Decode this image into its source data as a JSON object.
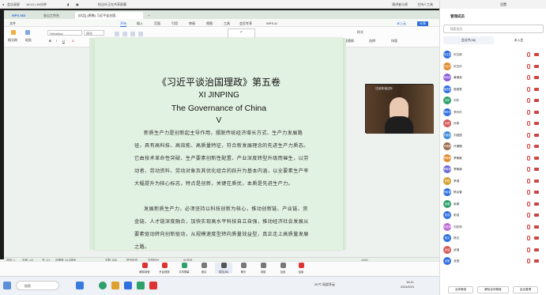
{
  "meeting": {
    "title": "会议录屏",
    "time": "16:10 | 48分钟",
    "presenter": "检达叶正在共享屏幕",
    "right_controls": [
      "演讲者与视",
      "主持人工具",
      "设置"
    ],
    "time_left": "16:11"
  },
  "browser_tabs": [
    {
      "label": "WPS 365"
    },
    {
      "label": "金山工作台"
    },
    {
      "label": "[印品] (原稿) 习近平谈治国..."
    }
  ],
  "wps_menu": [
    "文件",
    "开始",
    "插入",
    "页面",
    "引用",
    "审阅",
    "视图",
    "工具",
    "会员专享",
    "WPS AI"
  ],
  "wps_menu_active": "开始",
  "wps_right": [
    "未上云",
    "分享"
  ],
  "ribbon": {
    "format_painter": "格式刷",
    "font_name": "Helvetica",
    "font_size": "四号",
    "paste": "粘贴",
    "buttons": [
      "正文",
      "标题1",
      "标题2",
      "样式",
      "查找替换",
      "选择",
      "排版"
    ],
    "styles": [
      "正文",
      "标题 1",
      "标题 2"
    ]
  },
  "document": {
    "title": "《习近平谈治国理政》第五卷",
    "en1": "XI JINPING",
    "en2": "The Governance of China",
    "roman": "V",
    "p1": "新质生产力是创新起主导作用，摆脱传统经济增长方式、生产力发展路径，具有高科技、高效能、高质量特征，符合新发展理念的先进生产力质态。它由技术革命性突破、生产要素创新性配置、产业深度转型升级而催生，以劳动者、劳动资料、劳动对象及其优化组合的跃升为基本内涵，以全要素生产率大幅提升为核心标志，特点是创新，关键在质优，本质是先进生产力。",
    "p2": "发展新质生产力，必须坚持以科技创新为核心，推动创新链、产业链、资金链、人才链深度融合，加快实现高水平科技自立自强，推动经济社会发展从要素驱动转向创新驱动，从规模速度型转向质量效益型，真正走上高质量发展之路。"
  },
  "statusbar": [
    "页码: 1",
    "页面: 1/3",
    "节: 1/1",
    "设置值: 12.0厘米",
    "字数: 636",
    "拼写检查",
    "文档校对",
    "AI 校对",
    "116%"
  ],
  "video": {
    "name": "汪世鸿·检达叶"
  },
  "meeting_toolbar": {
    "buttons": [
      "解除静音",
      "开启视频",
      "共享屏幕",
      "邀请",
      "成员(36)",
      "聊天",
      "录制",
      "应用",
      "云录制",
      "结束"
    ]
  },
  "taskbar": {
    "search": "搜索",
    "weather": "26℃ 局部多云",
    "time": "16:11",
    "date": "2024/5/24"
  },
  "sidebar": {
    "title": "管理成员",
    "search_placeholder": "搜索成员",
    "tab_in": "会议中(36)",
    "tab_out": "未入会",
    "members": [
      {
        "name": "何玉英",
        "color": "#2f6fe0"
      },
      {
        "name": "何玉玲",
        "color": "#e08a2f"
      },
      {
        "name": "黄娴英",
        "color": "#8a5ad6"
      },
      {
        "name": "施丽君",
        "color": "#2f6fe0"
      },
      {
        "name": "刘华",
        "color": "#2fa06a"
      },
      {
        "name": "李玲玲",
        "color": "#2f6fe0"
      },
      {
        "name": "孙燕",
        "color": "#d65a5a"
      },
      {
        "name": "刘强国",
        "color": "#3a8ad6"
      },
      {
        "name": "许姗姗",
        "color": "#9a6a4a"
      },
      {
        "name": "罗敏敏",
        "color": "#e08a2f"
      },
      {
        "name": "罗敏格",
        "color": "#6a6ad6"
      },
      {
        "name": "罗瑾",
        "color": "#d6a02f"
      },
      {
        "name": "杨京春",
        "color": "#2f6fe0"
      },
      {
        "name": "俞春",
        "color": "#2fa06a"
      },
      {
        "name": "彭强",
        "color": "#2f6fe0"
      },
      {
        "name": "刘亚琼",
        "color": "#c06ad6"
      },
      {
        "name": "杨文",
        "color": "#2f6fe0"
      },
      {
        "name": "武瑞",
        "color": "#d65a5a"
      },
      {
        "name": "龙莹",
        "color": "#2f6fe0"
      }
    ],
    "buttons": [
      "全体静音",
      "解除全体静音",
      "会议管理"
    ]
  }
}
